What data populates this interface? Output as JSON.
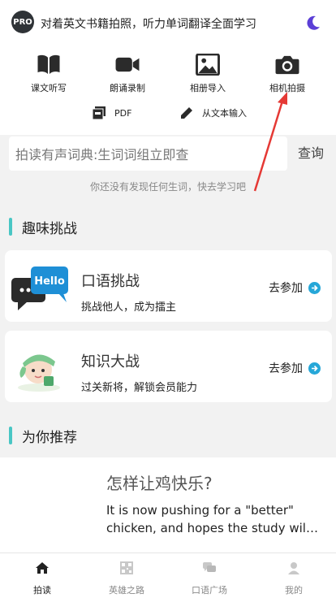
{
  "header": {
    "logo_text": "PRO",
    "title": "对着英文书籍拍照，听力单词翻译全面学习",
    "theme_icon": "moon-icon"
  },
  "tools": [
    {
      "label": "课文听写",
      "icon": "book-icon"
    },
    {
      "label": "朗诵录制",
      "icon": "video-camera-icon"
    },
    {
      "label": "相册导入",
      "icon": "image-icon"
    },
    {
      "label": "相机拍摄",
      "icon": "camera-icon"
    }
  ],
  "tools2": [
    {
      "label": "PDF",
      "icon": "pdf-icon"
    },
    {
      "label": "从文本输入",
      "icon": "pencil-icon"
    }
  ],
  "search": {
    "placeholder": "拍读有声词典:生词词组立即查",
    "button": "查询",
    "hint": "你还没有发现任何生词，快去学习吧"
  },
  "challenge_section": {
    "title": "趣味挑战",
    "cards": [
      {
        "title": "口语挑战",
        "subtitle": "挑战他人，成为擂主",
        "action": "去参加",
        "bubble_text": "Hello"
      },
      {
        "title": "知识大战",
        "subtitle": "过关新将，解锁会员能力",
        "action": "去参加"
      }
    ]
  },
  "recommend_section": {
    "title": "为你推荐",
    "article": {
      "title": "怎样让鸡快乐?",
      "line1": "It is now pushing for a \"better\"",
      "line2": "chicken, and hopes the study will ..."
    }
  },
  "tabbar": [
    {
      "label": "拍读",
      "icon": "home-icon",
      "active": true
    },
    {
      "label": "英雄之路",
      "icon": "qr-icon",
      "active": false
    },
    {
      "label": "口语广场",
      "icon": "chat-icon",
      "active": false
    },
    {
      "label": "我的",
      "icon": "person-icon",
      "active": false
    }
  ],
  "colors": {
    "accent": "#49c6c4",
    "arrow_button": "#26a7d8",
    "annotation": "#e53935",
    "moon": "#5b3fd6"
  }
}
